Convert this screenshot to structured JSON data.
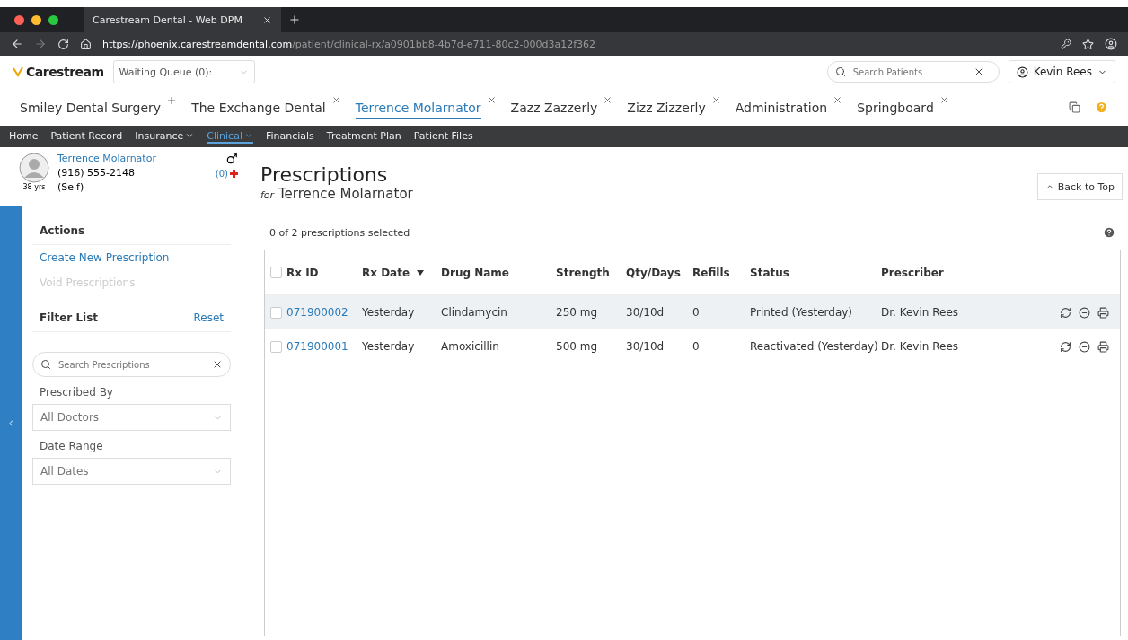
{
  "browser": {
    "tab_title": "Carestream Dental - Web DPM",
    "url_host": "https://phoenix.carestreamdental.com",
    "url_path": "/patient/clinical-rx/a0901bb8-4b7d-e711-80c2-000d3a12f362"
  },
  "header": {
    "logo": "Carestream",
    "waiting_queue": "Waiting Queue (0):",
    "search_placeholder": "Search Patients",
    "user": "Kevin Rees"
  },
  "workspace_tabs": [
    {
      "label": "Smiley Dental Surgery",
      "closable": false,
      "selected": false
    },
    {
      "label": "The Exchange Dental",
      "closable": true,
      "selected": false
    },
    {
      "label": "Terrence Molarnator",
      "closable": true,
      "selected": true
    },
    {
      "label": "Zazz Zazzerly",
      "closable": true,
      "selected": false
    },
    {
      "label": "Zizz Zizzerly",
      "closable": true,
      "selected": false
    },
    {
      "label": "Administration",
      "closable": true,
      "selected": false
    },
    {
      "label": "Springboard",
      "closable": true,
      "selected": false
    }
  ],
  "nav": [
    {
      "label": "Home",
      "dropdown": false,
      "selected": false
    },
    {
      "label": "Patient Record",
      "dropdown": false,
      "selected": false
    },
    {
      "label": "Insurance",
      "dropdown": true,
      "selected": false
    },
    {
      "label": "Clinical",
      "dropdown": true,
      "selected": true
    },
    {
      "label": "Financials",
      "dropdown": false,
      "selected": false
    },
    {
      "label": "Treatment Plan",
      "dropdown": false,
      "selected": false
    },
    {
      "label": "Patient Files",
      "dropdown": false,
      "selected": false
    }
  ],
  "patient": {
    "name": "Terrence Molarnator",
    "phone": "(916) 555-2148",
    "age": "38 yrs",
    "relation": "(Self)",
    "alerts": "(0)"
  },
  "sidebar": {
    "actions_title": "Actions",
    "actions": [
      {
        "label": "Create New Prescription",
        "disabled": false
      },
      {
        "label": "Void Prescriptions",
        "disabled": true
      }
    ],
    "filter_title": "Filter List",
    "reset": "Reset",
    "search_placeholder": "Search Prescriptions",
    "filters": [
      {
        "label": "Prescribed By",
        "value": "All Doctors"
      },
      {
        "label": "Date Range",
        "value": "All Dates"
      }
    ]
  },
  "page": {
    "title": "Prescriptions",
    "subtitle_prefix": "for",
    "subtitle_name": "Terrence Molarnator",
    "back_to_top": "Back to Top",
    "selection_count": "0 of 2 prescriptions selected"
  },
  "table": {
    "select_all_checked": false,
    "columns": [
      {
        "label": "Rx ID",
        "sorted": false
      },
      {
        "label": "Rx Date",
        "sorted": true
      },
      {
        "label": "Drug Name",
        "sorted": false
      },
      {
        "label": "Strength",
        "sorted": false
      },
      {
        "label": "Qty/Days",
        "sorted": false
      },
      {
        "label": "Refills",
        "sorted": false
      },
      {
        "label": "Status",
        "sorted": false
      },
      {
        "label": "Prescriber",
        "sorted": false
      }
    ],
    "rows": [
      {
        "selected": false,
        "highlighted": true,
        "cells": [
          "071900002",
          "Yesterday",
          "Clindamycin",
          "250 mg",
          "30/10d",
          "0",
          "Printed (Yesterday)",
          "Dr. Kevin Rees"
        ]
      },
      {
        "selected": false,
        "highlighted": false,
        "cells": [
          "071900001",
          "Yesterday",
          "Amoxicillin",
          "500 mg",
          "30/10d",
          "0",
          "Reactivated (Yesterday)",
          "Dr. Kevin Rees"
        ]
      }
    ]
  }
}
